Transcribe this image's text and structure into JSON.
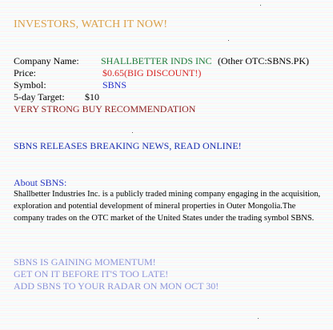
{
  "headline": "INVESTORS, WATCH IT NOW!",
  "details": {
    "company_label": "Company Name:",
    "company_value": "SHALLBETTER INDS INC",
    "company_extra": "(Other OTC:SBNS.PK)",
    "price_label": "Price:",
    "price_value": "$0.65(BIG DISCOUNT!)",
    "symbol_label": "Symbol:",
    "symbol_value": "SBNS",
    "target_label": "5-day Target:",
    "target_value": "$10"
  },
  "recommendation": "VERY STRONG BUY RECOMMENDATION",
  "news": "SBNS RELEASES BREAKING NEWS, READ ONLINE!",
  "about": {
    "title": "About SBNS:",
    "text": "Shallbetter Industries Inc. is a publicly traded mining company engaging in the acquisition, exploration and potential development of mineral properties in Outer Mongolia.The company trades on the OTC market of the United States under the trading symbol SBNS."
  },
  "promo": [
    "SBNS IS GAINING MOMENTUM!",
    "GET ON IT BEFORE IT'S TOO LATE!",
    "ADD SBNS TO YOUR RADAR ON MON OCT 30!"
  ],
  "colors": {
    "headline": "#d9a04a",
    "company": "#1e7a3a",
    "price": "#d62626",
    "symbol": "#2430c8",
    "recommendation": "#8b1e1e",
    "news": "#1a2db0",
    "promo": "#8c93d9"
  }
}
